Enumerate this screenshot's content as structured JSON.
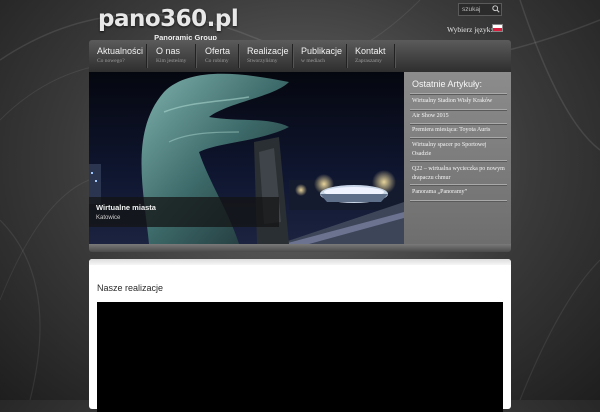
{
  "header": {
    "logo_main": "pano360.pl",
    "logo_sub": "Panoramic Group",
    "search_placeholder": "szukaj",
    "language_label": "Wybierz język:"
  },
  "nav": {
    "items": [
      {
        "title": "Aktualności",
        "sub": "Co nowego?"
      },
      {
        "title": "O nas",
        "sub": "Kim jesteśmy"
      },
      {
        "title": "Oferta",
        "sub": "Co robimy"
      },
      {
        "title": "Realizacje",
        "sub": "Stworzyliśmy"
      },
      {
        "title": "Publikacje",
        "sub": "w mediach"
      },
      {
        "title": "Kontakt",
        "sub": "Zapraszamy"
      }
    ]
  },
  "hero": {
    "caption_title": "Wirtualne miasta",
    "caption_sub": "Katowice"
  },
  "articles": {
    "heading": "Ostatnie Artykuły:",
    "items": [
      "Wirtualny Stadion Wisły Kraków",
      "Air Show 2015",
      "Premiera miesiąca: Toyota Auris",
      "Wirtualny spacer po Sportowej Osadzie",
      "Q22 – wirtualna wycieczka po nowym drapaczu chmur",
      "Panorama „Panoramy”"
    ]
  },
  "content": {
    "section_title": "Nasze realizacje"
  },
  "colors": {
    "background": "#3a3a3a",
    "nav_bar": "#3c3c3c",
    "sidebar": "#7d7d7d",
    "panel": "#ffffff",
    "flag_red": "#d81e3d"
  },
  "icons": {
    "search": "magnifier-icon",
    "language_flag": "poland-flag-icon"
  }
}
